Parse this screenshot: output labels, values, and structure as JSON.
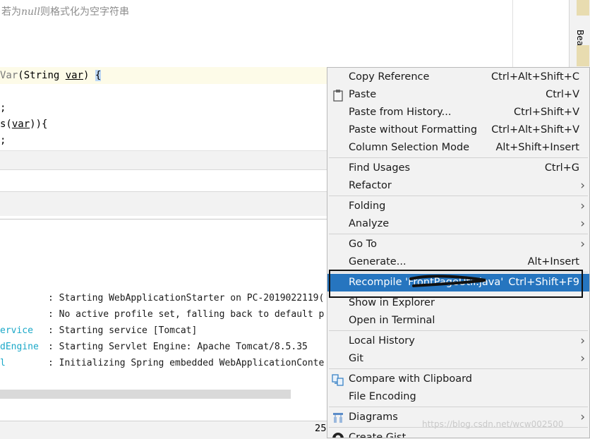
{
  "editor": {
    "comment_prefix": "若为",
    "comment_null": "null",
    "comment_suffix": "则格式化为空字符串",
    "sig_name": "Var",
    "sig_paren": "(String ",
    "sig_var": "var",
    "sig_close": ") ",
    "sig_brace": "{",
    "line_a": ";",
    "line_b_pre": "s(",
    "line_b_var": "var",
    "line_b_post": ")){",
    "line_c": ";"
  },
  "right_tool": {
    "label": "Bean"
  },
  "console": {
    "lines": [
      {
        "src": "",
        "text": ": Starting WebApplicationStarter on PC-2019022119("
      },
      {
        "src": "",
        "text": ": No active profile set, falling back to default p"
      },
      {
        "src": "ervice",
        "text": ": Starting service [Tomcat]"
      },
      {
        "src": "dEngine",
        "text": ": Starting Servlet Engine: Apache Tomcat/8.5.35"
      },
      {
        "src": "l",
        "text": ": Initializing Spring embedded WebApplicationConte"
      }
    ]
  },
  "status": {
    "partial_number": "25"
  },
  "menu": {
    "items": [
      {
        "label": "Copy Reference",
        "shortcut": "Ctrl+Alt+Shift+C"
      },
      {
        "label": "Paste",
        "shortcut": "Ctrl+V",
        "icon": "clipboard-icon"
      },
      {
        "label": "Paste from History...",
        "shortcut": "Ctrl+Shift+V"
      },
      {
        "label": "Paste without Formatting",
        "shortcut": "Ctrl+Alt+Shift+V"
      },
      {
        "label": "Column Selection Mode",
        "shortcut": "Alt+Shift+Insert"
      },
      {
        "label": "Find Usages",
        "shortcut": "Ctrl+G"
      },
      {
        "label": "Refactor",
        "submenu": true
      },
      {
        "label": "Folding",
        "submenu": true
      },
      {
        "label": "Analyze",
        "submenu": true
      },
      {
        "label": "Go To",
        "submenu": true
      },
      {
        "label": "Generate...",
        "shortcut": "Alt+Insert"
      },
      {
        "label": "Recompile 'FrontPageUtil.java'",
        "shortcut": "Ctrl+Shift+F9",
        "selected": true
      },
      {
        "label": "Show in Explorer",
        "shortcut": ""
      },
      {
        "label": "Open in Terminal",
        "shortcut": ""
      },
      {
        "label": "Local History",
        "submenu": true
      },
      {
        "label": "Git",
        "submenu": true
      },
      {
        "label": "Compare with Clipboard",
        "icon": "compare-icon"
      },
      {
        "label": "File Encoding"
      },
      {
        "label": "Diagrams",
        "submenu": true,
        "icon": "diagram-icon"
      },
      {
        "label": "Create Gist...",
        "icon": "github-icon"
      }
    ]
  },
  "watermark": "https://blog.csdn.net/wcw002500",
  "colors": {
    "selection": "#2675bf",
    "menu_bg": "#f2f2f2",
    "console_cyan": "#1ba8c8"
  }
}
